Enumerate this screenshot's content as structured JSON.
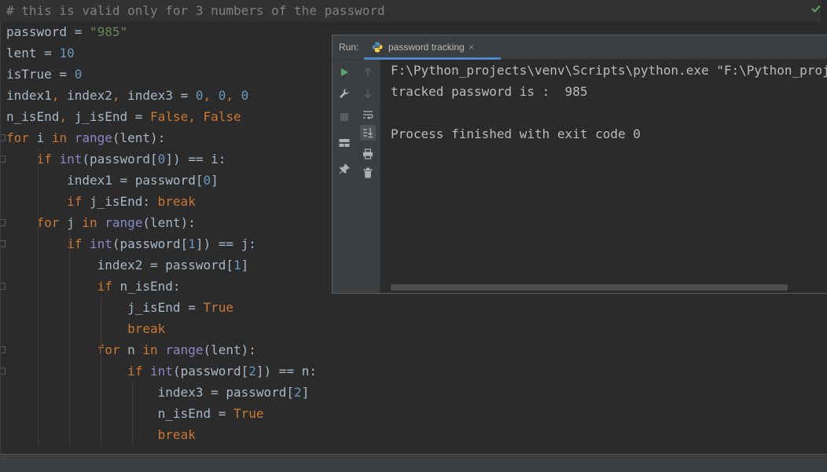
{
  "editor": {
    "lines": [
      [
        {
          "t": "# this is valid only for 3 numbers of the password",
          "c": "t-comment"
        }
      ],
      [
        {
          "t": "password = "
        },
        {
          "t": "\"985\"",
          "c": "t-str"
        }
      ],
      [
        {
          "t": "lent = "
        },
        {
          "t": "10",
          "c": "t-num"
        }
      ],
      [
        {
          "t": "isTrue = "
        },
        {
          "t": "0",
          "c": "t-num"
        }
      ],
      [
        {
          "t": "index1"
        },
        {
          "t": ",",
          "c": "t-kw"
        },
        {
          "t": " index2"
        },
        {
          "t": ",",
          "c": "t-kw"
        },
        {
          "t": " index3 = "
        },
        {
          "t": "0",
          "c": "t-num"
        },
        {
          "t": ", ",
          "c": "t-kw"
        },
        {
          "t": "0",
          "c": "t-num"
        },
        {
          "t": ", ",
          "c": "t-kw"
        },
        {
          "t": "0",
          "c": "t-num"
        }
      ],
      [
        {
          "t": "n_isEnd"
        },
        {
          "t": ",",
          "c": "t-kw"
        },
        {
          "t": " j_isEnd = "
        },
        {
          "t": "False",
          "c": "t-kw"
        },
        {
          "t": ", ",
          "c": "t-kw"
        },
        {
          "t": "False",
          "c": "t-kw"
        }
      ],
      [
        {
          "t": "for",
          "c": "t-kw"
        },
        {
          "t": " i "
        },
        {
          "t": "in",
          "c": "t-kw"
        },
        {
          "t": " "
        },
        {
          "t": "range",
          "c": "t-builtin"
        },
        {
          "t": "(lent):"
        }
      ],
      [
        {
          "t": "    "
        },
        {
          "t": "if",
          "c": "t-kw"
        },
        {
          "t": " "
        },
        {
          "t": "int",
          "c": "t-builtin"
        },
        {
          "t": "(password["
        },
        {
          "t": "0",
          "c": "t-num"
        },
        {
          "t": "]) == i:"
        }
      ],
      [
        {
          "t": "        index1 = password["
        },
        {
          "t": "0",
          "c": "t-num"
        },
        {
          "t": "]"
        }
      ],
      [
        {
          "t": "        "
        },
        {
          "t": "if",
          "c": "t-kw"
        },
        {
          "t": " j_isEnd: "
        },
        {
          "t": "break",
          "c": "t-kw"
        }
      ],
      [
        {
          "t": "    "
        },
        {
          "t": "for",
          "c": "t-kw"
        },
        {
          "t": " j "
        },
        {
          "t": "in",
          "c": "t-kw"
        },
        {
          "t": " "
        },
        {
          "t": "range",
          "c": "t-builtin"
        },
        {
          "t": "(lent):"
        }
      ],
      [
        {
          "t": "        "
        },
        {
          "t": "if",
          "c": "t-kw"
        },
        {
          "t": " "
        },
        {
          "t": "int",
          "c": "t-builtin"
        },
        {
          "t": "(password["
        },
        {
          "t": "1",
          "c": "t-num"
        },
        {
          "t": "]) == j:"
        }
      ],
      [
        {
          "t": "            index2 = password["
        },
        {
          "t": "1",
          "c": "t-num"
        },
        {
          "t": "]"
        }
      ],
      [
        {
          "t": "            "
        },
        {
          "t": "if",
          "c": "t-kw"
        },
        {
          "t": " n_isEnd:"
        }
      ],
      [
        {
          "t": "                j_isEnd = "
        },
        {
          "t": "True",
          "c": "t-kw"
        }
      ],
      [
        {
          "t": "                "
        },
        {
          "t": "break",
          "c": "t-kw"
        }
      ],
      [
        {
          "t": "            "
        },
        {
          "t": "for",
          "c": "t-kw"
        },
        {
          "t": " n "
        },
        {
          "t": "in",
          "c": "t-kw"
        },
        {
          "t": " "
        },
        {
          "t": "range",
          "c": "t-builtin"
        },
        {
          "t": "(lent):"
        }
      ],
      [
        {
          "t": "                "
        },
        {
          "t": "if",
          "c": "t-kw"
        },
        {
          "t": " "
        },
        {
          "t": "int",
          "c": "t-builtin"
        },
        {
          "t": "(password["
        },
        {
          "t": "2",
          "c": "t-num"
        },
        {
          "t": "]) == n:"
        }
      ],
      [
        {
          "t": "                    index3 = password["
        },
        {
          "t": "2",
          "c": "t-num"
        },
        {
          "t": "]"
        }
      ],
      [
        {
          "t": "                    n_isEnd = "
        },
        {
          "t": "True",
          "c": "t-kw"
        }
      ],
      [
        {
          "t": "                    "
        },
        {
          "t": "break",
          "c": "t-kw"
        }
      ]
    ]
  },
  "run_panel": {
    "label": "Run:",
    "tab_label": "password tracking",
    "tab_close": "×",
    "console_lines": [
      "F:\\Python_projects\\venv\\Scripts\\python.exe \"F:\\Python_projects\\password tracking.py\"",
      "tracked password is :  985",
      "",
      "Process finished with exit code 0"
    ],
    "toolbar_icons_left": [
      "run-icon",
      "wrench-icon",
      "stop-icon",
      "layout-icon",
      "pin-icon"
    ],
    "toolbar_icons_right": [
      "up-arrow-icon",
      "down-arrow-icon",
      "soft-wrap-icon",
      "scroll-to-end-icon",
      "print-icon",
      "trash-icon"
    ]
  },
  "colors": {
    "background": "#2b2b2b",
    "keyword": "#cc7832",
    "string": "#6a8759",
    "number": "#6897bb",
    "builtin": "#8888c6",
    "comment": "#808080",
    "run_green": "#59a869",
    "tab_underline": "#4a88c7"
  }
}
